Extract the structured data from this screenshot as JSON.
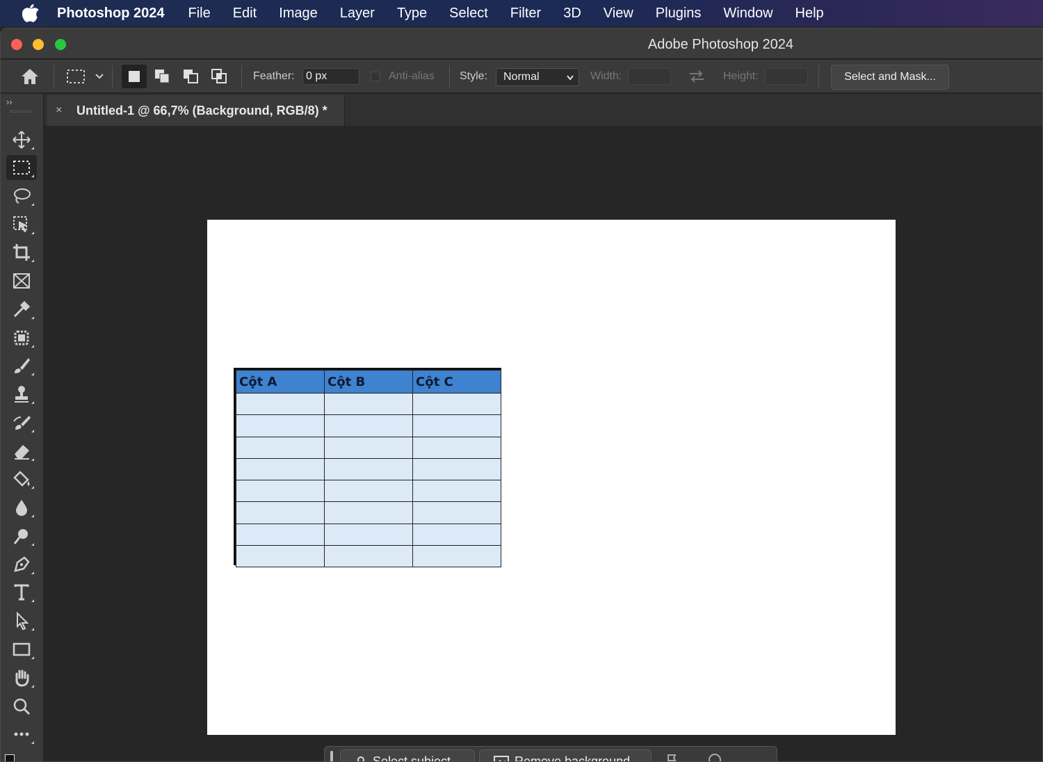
{
  "menubar": {
    "app_name": "Photoshop 2024",
    "items": [
      "File",
      "Edit",
      "Image",
      "Layer",
      "Type",
      "Select",
      "Filter",
      "3D",
      "View",
      "Plugins",
      "Window",
      "Help"
    ]
  },
  "window": {
    "title": "Adobe Photoshop 2024"
  },
  "options": {
    "feather_label": "Feather:",
    "feather_value": "0 px",
    "antialias_label": "Anti-alias",
    "style_label": "Style:",
    "style_value": "Normal",
    "width_label": "Width:",
    "height_label": "Height:",
    "select_mask_label": "Select and Mask..."
  },
  "document": {
    "tab_title": "Untitled-1 @ 66,7% (Background, RGB/8) *",
    "close_glyph": "×"
  },
  "sheet": {
    "headers": [
      "Cột A",
      "Cột B",
      "Cột C"
    ],
    "empty_rows": 8
  },
  "taskbar": {
    "select_subject_label": "Select subject",
    "remove_background_label": "Remove background"
  },
  "toolbar": {
    "collapse_glyph": "››",
    "tools": [
      "move-icon",
      "rectangular-marquee-icon",
      "lasso-icon",
      "object-selection-icon",
      "crop-icon",
      "frame-icon",
      "eyedropper-icon",
      "spot-healing-icon",
      "brush-icon",
      "clone-stamp-icon",
      "history-brush-icon",
      "eraser-icon",
      "paint-bucket-icon",
      "blur-icon",
      "dodge-icon",
      "pen-icon",
      "type-icon",
      "path-selection-icon",
      "rectangle-icon",
      "hand-icon",
      "zoom-icon",
      "more-icon"
    ]
  },
  "colors": {
    "header_fill": "#3f82d0",
    "cell_fill": "#dce9f7",
    "canvas_bg": "#ffffff",
    "workspace_bg": "#262626"
  }
}
